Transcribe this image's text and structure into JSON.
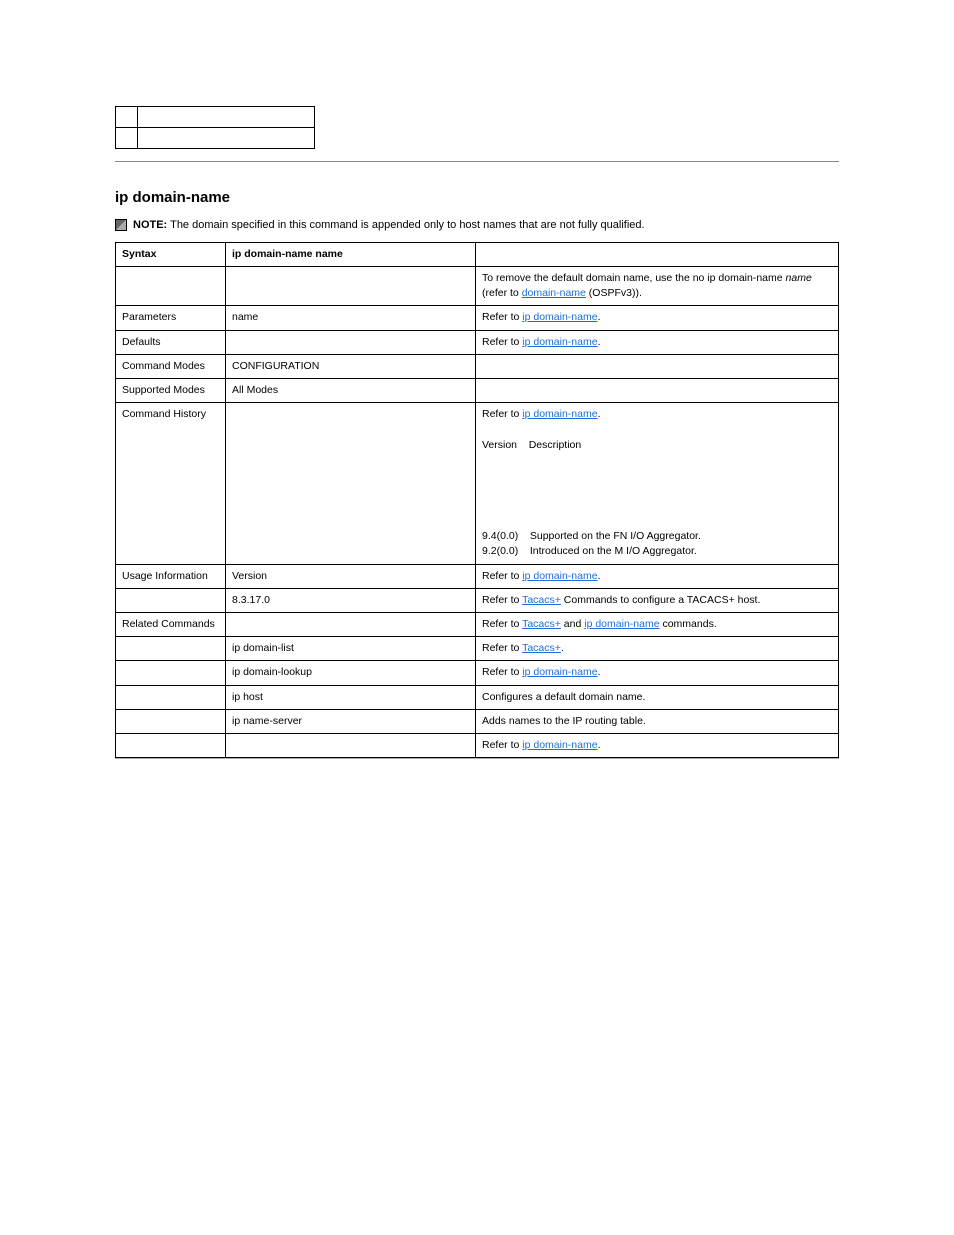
{
  "heading": "ip domain-name",
  "note_label": "NOTE:",
  "note_text": "The domain specified in this command is appended only to host names that are not fully qualified.",
  "table": {
    "headers": [
      "Syntax",
      "ip domain-name  name",
      ""
    ],
    "rows": [
      {
        "c1": "",
        "c2": "",
        "c3_parts": [
          {
            "text": "To remove the default domain name, use the no ip domain-name "
          },
          {
            "text": "name",
            "class": "italic"
          },
          {
            "text": " (refer to "
          },
          {
            "text": "domain-name",
            "link": true
          },
          {
            "text": " (OSPFv3))."
          }
        ]
      },
      {
        "c1": "Parameters",
        "c2": "name",
        "c3_parts": [
          {
            "text": "Refer to "
          },
          {
            "text": "ip domain-name",
            "link": true
          },
          {
            "text": "."
          }
        ]
      },
      {
        "c1": "Defaults",
        "c2": "",
        "c3_parts": [
          {
            "text": "Refer to "
          },
          {
            "text": "ip domain-name",
            "link": true
          },
          {
            "text": "."
          }
        ]
      },
      {
        "c1": "Command Modes",
        "c2": "CONFIGURATION",
        "c3": ""
      },
      {
        "c1": "Supported Modes",
        "c2": "All Modes",
        "c3": ""
      },
      {
        "c1": "Command History",
        "c2": "",
        "c3_parts": [
          {
            "text": "Refer to "
          },
          {
            "text": "ip domain-name",
            "link": true
          },
          {
            "text": "."
          }
        ],
        "c3_extra": "Version    Description\n\n\n\n\n\n9.4(0.0)    Supported on the FN I/O Aggregator.\n9.2(0.0)    Introduced on the M I/O Aggregator."
      },
      {
        "c1": "Usage Information",
        "c2": "Version",
        "c3_parts": [
          {
            "text": "Refer to "
          },
          {
            "text": "ip domain-name",
            "link": true
          },
          {
            "text": "."
          }
        ]
      },
      {
        "c1": "",
        "c2": "8.3.17.0",
        "c3_parts": [
          {
            "text": "Refer to "
          },
          {
            "text": "Tacacs+",
            "link": true
          },
          {
            "text": " Commands  to configure a TACACS+ host."
          }
        ]
      },
      {
        "c1": "Related Commands",
        "c2": "",
        "c3_parts": [
          {
            "text": "Refer to "
          },
          {
            "text": "Tacacs+",
            "link": true
          },
          {
            "text": " and "
          },
          {
            "text": "ip domain-name",
            "link": true
          },
          {
            "text": " commands."
          }
        ]
      },
      {
        "c1": "",
        "c2": "ip domain-list",
        "c3_parts": [
          {
            "text": "Refer to "
          },
          {
            "text": "Tacacs+",
            "link": true
          },
          {
            "text": "."
          }
        ]
      },
      {
        "c1": "",
        "c2": "ip domain-lookup",
        "c3_parts": [
          {
            "text": "Refer to "
          },
          {
            "text": "ip domain-name",
            "link": true
          },
          {
            "text": "."
          }
        ]
      },
      {
        "c1": "",
        "c2": "ip host",
        "c3": "Configures a default domain name."
      },
      {
        "c1": "",
        "c2": "ip name-server",
        "c3": "Adds names to the IP routing table."
      },
      {
        "c1": "",
        "c2": "",
        "c3_parts": [
          {
            "text": "Refer to "
          },
          {
            "text": "ip domain-name",
            "link": true
          },
          {
            "text": "."
          }
        ]
      }
    ]
  }
}
